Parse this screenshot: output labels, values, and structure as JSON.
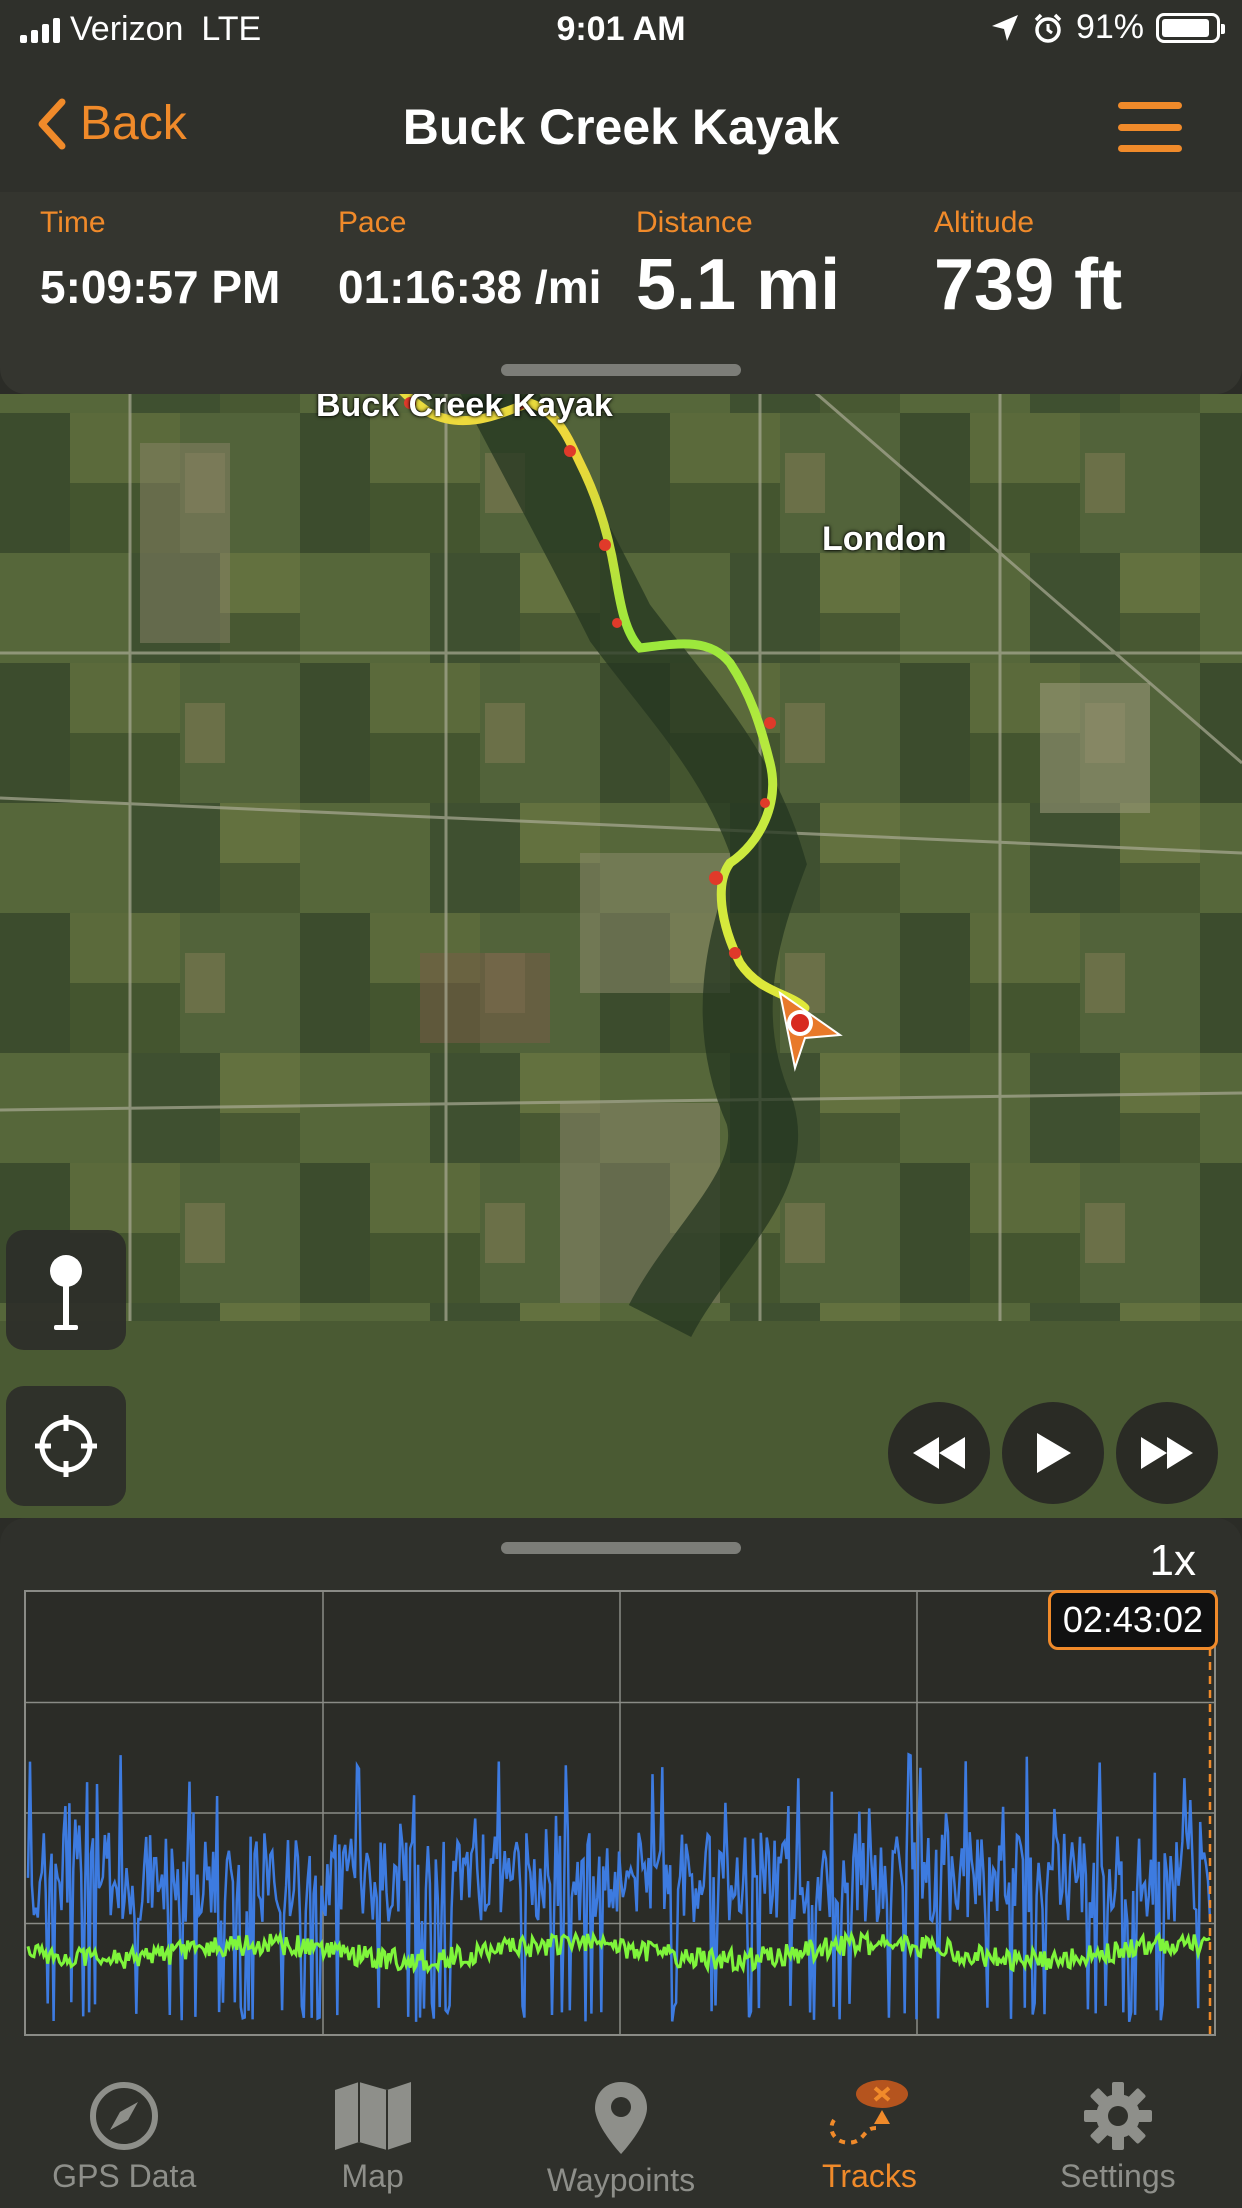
{
  "status_bar": {
    "carrier": "Verizon",
    "network": "LTE",
    "time": "9:01 AM",
    "battery": "91%",
    "battery_level": 0.91
  },
  "nav": {
    "back_label": "Back",
    "title": "Buck Creek Kayak"
  },
  "stats": {
    "time_label": "Time",
    "time_value": "5:09:57 PM",
    "pace_label": "Pace",
    "pace_value": "01:16:38 /mi",
    "distance_label": "Distance",
    "distance_value": "5.1 mi",
    "altitude_label": "Altitude",
    "altitude_value": "739 ft"
  },
  "map": {
    "track_label": "Buck Creek Kayak",
    "town_label": "London"
  },
  "graph": {
    "speed": "1x",
    "current_time": "02:43:02",
    "colors": {
      "speed_series": "#3d7be0",
      "altitude_series": "#7ff53b",
      "cursor": "#f08a2a"
    }
  },
  "tabs": [
    {
      "label": "GPS Data",
      "icon": "compass-icon"
    },
    {
      "label": "Map",
      "icon": "map-icon"
    },
    {
      "label": "Waypoints",
      "icon": "waypoint-pin-icon"
    },
    {
      "label": "Tracks",
      "icon": "tracks-icon"
    },
    {
      "label": "Settings",
      "icon": "gear-icon"
    }
  ],
  "colors": {
    "accent": "#f08a2a",
    "background": "#2f302b"
  }
}
